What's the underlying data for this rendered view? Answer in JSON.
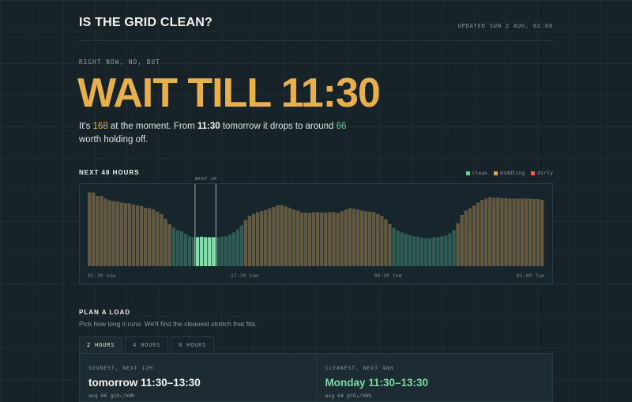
{
  "header": {
    "brand": "IS THE GRID CLEAN?",
    "updated": "UPDATED SUN 2 AUG, 02:00"
  },
  "hero": {
    "eyebrow": "RIGHT NOW, NO, BUT",
    "headline": "WAIT TILL 11:30",
    "summary_pre": "It's ",
    "current_value": "168",
    "summary_mid": " at the moment. From ",
    "from_time": "11:30",
    "summary_mid2": " tomorrow it drops to around ",
    "target_value": "66",
    "summary_post": " worth holding off."
  },
  "forecast": {
    "title": "NEXT 48 HOURS",
    "legend": [
      {
        "label": "clean",
        "color": "#6ad19a"
      },
      {
        "label": "middling",
        "color": "#e0a44a"
      },
      {
        "label": "dirty",
        "color": "#e06a5a"
      }
    ],
    "best_label": "BEST 2H",
    "x_ticks": [
      "01:30 now",
      "17:30 tom",
      "09:30 tom",
      "01:00 Tue"
    ]
  },
  "chart_data": {
    "type": "bar",
    "title": "NEXT 48 HOURS",
    "unit": "gCO2/kWh",
    "series": [
      {
        "values": [
          168,
          168,
          160,
          160,
          154,
          150,
          148,
          147,
          145,
          144,
          143,
          140,
          138,
          137,
          133,
          132,
          129,
          124,
          119,
          108,
          96,
          88,
          82,
          79,
          74,
          68,
          66,
          66,
          67,
          66,
          66,
          66,
          66,
          67,
          68,
          72,
          77,
          84,
          93,
          105,
          115,
          119,
          123,
          126,
          128,
          132,
          135,
          139,
          139,
          136,
          133,
          129,
          127,
          122,
          122,
          121,
          123,
          123,
          122,
          122,
          123,
          123,
          121,
          125,
          129,
          132,
          131,
          129,
          127,
          125,
          124,
          123,
          119,
          114,
          107,
          96,
          87,
          81,
          77,
          74,
          71,
          68,
          67,
          65,
          64,
          64,
          66,
          66,
          68,
          70,
          75,
          82,
          98,
          117,
          127,
          132,
          138,
          145,
          151,
          154,
          157,
          156,
          156,
          155,
          155,
          154,
          154,
          154,
          154,
          154,
          154,
          153,
          153,
          151
        ]
      }
    ],
    "categories_note": "hourly slots from 01:30 now to 01:00 Tue",
    "x_tick_labels": [
      "01:30 now",
      "17:30 tom",
      "09:30 tom",
      "01:00 Tue"
    ],
    "ylim": [
      0,
      180
    ],
    "clean_threshold": 95,
    "best_window": {
      "start_index": 27,
      "end_index": 31,
      "label": "BEST 2H"
    },
    "colors": {
      "clean": "#2f5d53",
      "middling": "#635941",
      "best": "#7ee2a8"
    }
  },
  "plan": {
    "title": "PLAN A LOAD",
    "subtitle": "Pick how long it runs. We'll find the cleanest stretch that fits.",
    "tabs": [
      "2 HOURS",
      "4 HOURS",
      "8 HOURS"
    ],
    "active_tab": 0,
    "cards": [
      {
        "label": "SOONEST, NEXT 12H",
        "time": "tomorrow 11:30–13:30",
        "avg": "avg 66 gCO₂/kWh"
      },
      {
        "label": "CLEANEST, NEXT 48H",
        "time": "Monday 11:30–13:30",
        "avg": "avg 64 gCO₂/kWh"
      }
    ]
  }
}
